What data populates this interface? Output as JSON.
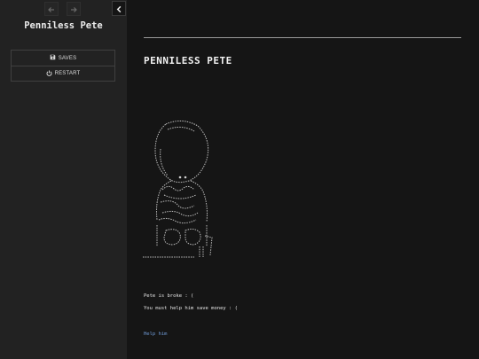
{
  "sidebar": {
    "title": "Penniless Pete",
    "menu": {
      "saves_label": "SAVES",
      "restart_label": "RESTART"
    },
    "icons": {
      "back": "arrow-left-icon",
      "forward": "arrow-right-icon",
      "collapse": "chevron-left-icon",
      "saves": "save-icon",
      "restart": "power-icon"
    }
  },
  "passage": {
    "heading": "PENNILESS PETE",
    "lines": [
      "Pete is broke : (",
      "You must help him save money : ("
    ],
    "link": "Help him"
  },
  "colors": {
    "sidebar_bg": "#222222",
    "main_bg": "#151515",
    "link": "#6f9ad6"
  }
}
